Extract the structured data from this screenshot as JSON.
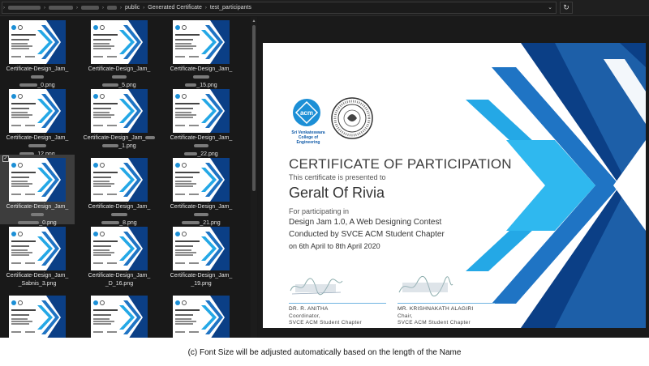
{
  "address_bar": {
    "crumbs": [
      "public",
      "Generated Certificate",
      "test_participants"
    ],
    "expand_icon": "chevron-down-icon",
    "refresh_icon": "refresh-icon"
  },
  "thumbnails": [
    {
      "caption_start": "Certificate-Design_Jam_",
      "caption_end": "_0.png"
    },
    {
      "caption_start": "Certificate-Design_Jam_",
      "caption_end": "_5.png"
    },
    {
      "caption_start": "Certificate-Design_Jam_",
      "caption_end": "_15.png"
    },
    {
      "caption_start": "Certificate-Design_Jam_",
      "caption_end": "_12.png"
    },
    {
      "caption_start": "Certificate-Design_Jam_",
      "caption_end": "_1.png"
    },
    {
      "caption_start": "Certificate-Design_Jam_",
      "caption_end": "_22.png"
    },
    {
      "caption_start": "Certificate-Design_Jam_",
      "caption_end": "_0.png",
      "selected": true
    },
    {
      "caption_start": "Certificate-Design_Jam_",
      "caption_end": "_8.png"
    },
    {
      "caption_start": "Certificate-Design_Jam_",
      "caption_end": "_21.png"
    },
    {
      "caption_start": "Certificate-Design_Jam_",
      "caption_end": "_Sabnis_3.png"
    },
    {
      "caption_start": "Certificate-Design_Jam_",
      "caption_end": "_D_16.png"
    },
    {
      "caption_start": "Certificate-Design_Jam_",
      "caption_end": "_19.png"
    },
    {
      "caption_start": "",
      "caption_end": ""
    },
    {
      "caption_start": "",
      "caption_end": ""
    },
    {
      "caption_start": "",
      "caption_end": ""
    }
  ],
  "certificate": {
    "acm_logo_text": "acm",
    "acm_college_line1": "Sri Venkateswara",
    "acm_college_line2": "College of Engineering",
    "title": "CERTIFICATE OF PARTICIPATION",
    "presented": "This certificate is presented to",
    "name": "Geralt Of Rivia",
    "participating": "For participating in",
    "event": "Design Jam 1.0, A Web Designing Contest",
    "conducted": "Conducted by SVCE ACM Student Chapter",
    "dates": "on 6th April to 8th April 2020",
    "signatories": [
      {
        "name": "DR. R. ANITHA",
        "role": "Coordinator,",
        "org": "SVCE ACM Student Chapter"
      },
      {
        "name": "MR. KRISHNAKATH ALAGIRI",
        "role": "Chair,",
        "org": "SVCE ACM Student Chapter"
      }
    ],
    "colors": {
      "dark_blue": "#0b3f86",
      "mid_blue": "#1f74c4",
      "light_blue": "#24a8e6"
    }
  },
  "figure_caption": "(c) Font Size will be adjusted automatically based on the length of the Name"
}
